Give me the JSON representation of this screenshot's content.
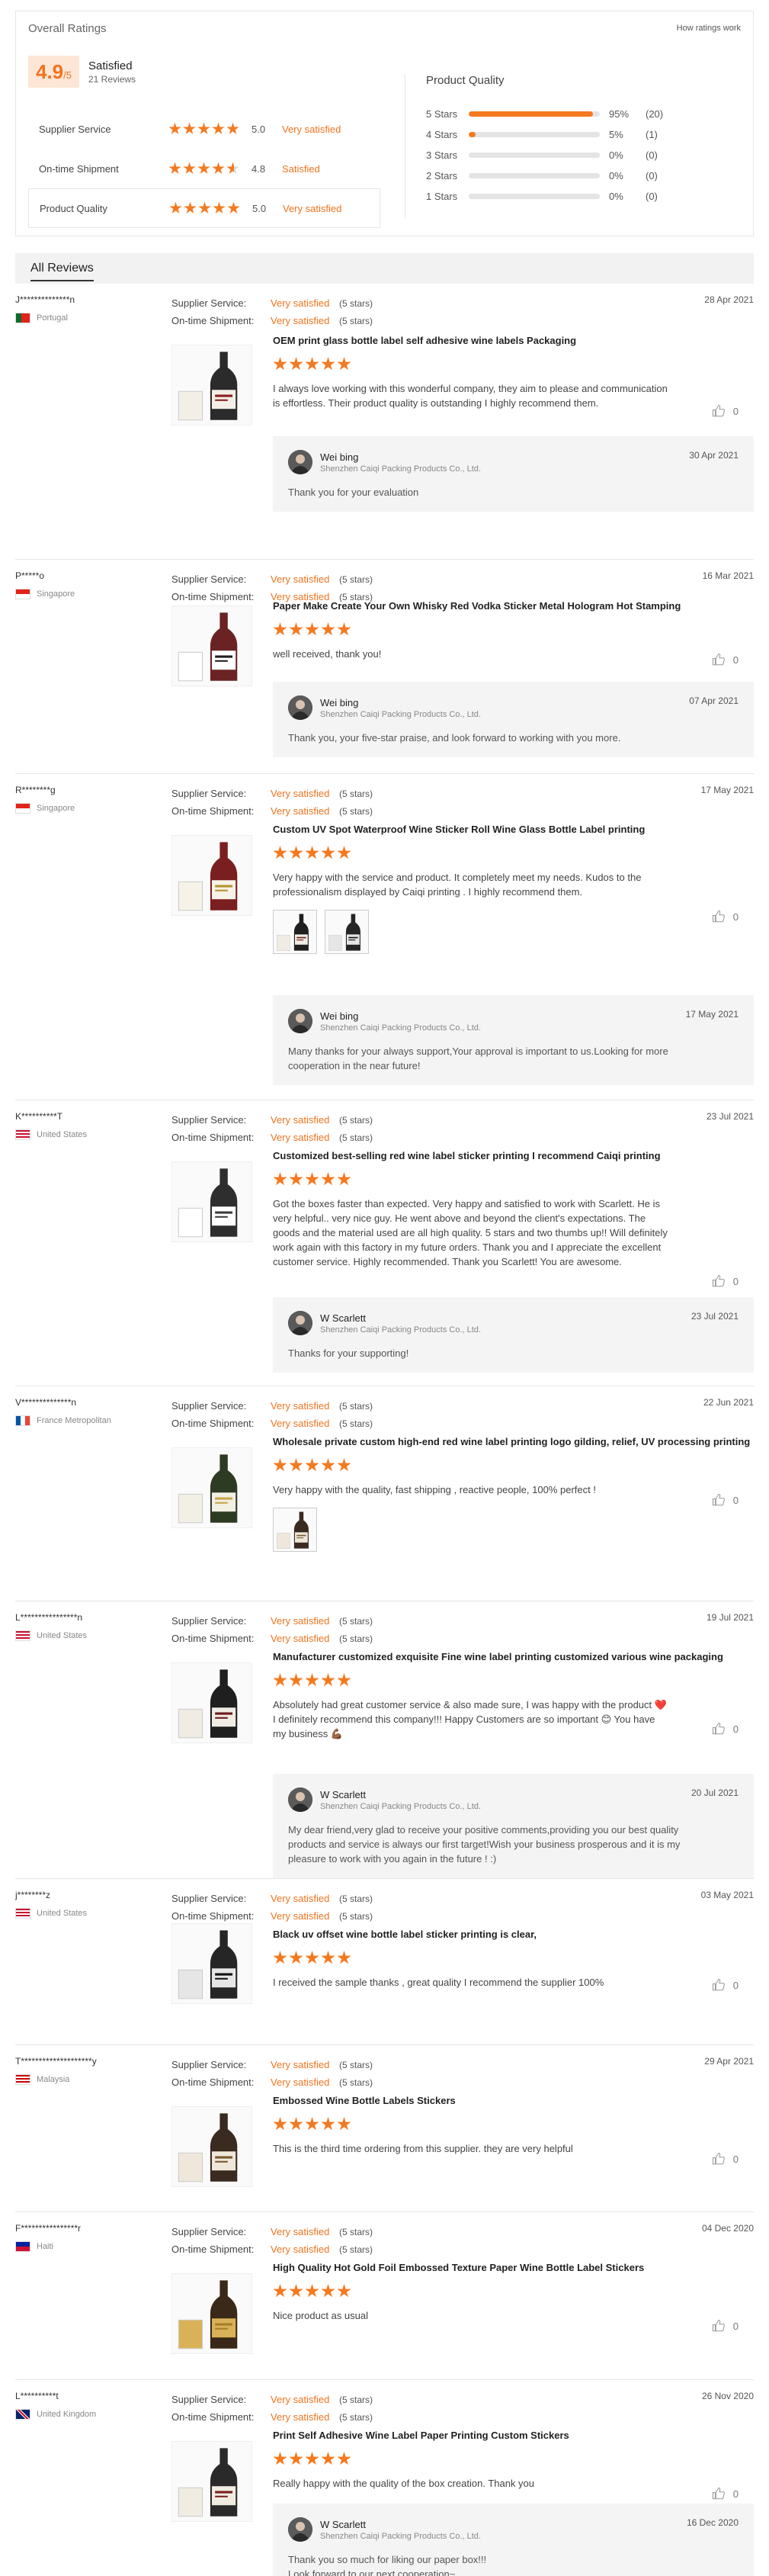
{
  "overall": {
    "title": "Overall Ratings",
    "how_link": "How ratings work",
    "score_main": "4.9",
    "score_sub": "/5",
    "status": "Satisfied",
    "reviews_count": "21 Reviews",
    "sub_ratings": [
      {
        "label": "Supplier Service",
        "value": "5.0",
        "stars": 5,
        "word": "Very satisfied"
      },
      {
        "label": "On-time Shipment",
        "value": "4.8",
        "stars": 4.8,
        "word": "Satisfied"
      },
      {
        "label": "Product Quality",
        "value": "5.0",
        "stars": 5,
        "word": "Very satisfied"
      }
    ],
    "product_quality": {
      "title": "Product Quality",
      "rows": [
        {
          "label": "5 Stars",
          "fraction": 0.95,
          "pct": "95%",
          "count": "(20)"
        },
        {
          "label": "4 Stars",
          "fraction": 0.05,
          "pct": "5%",
          "count": "(1)"
        },
        {
          "label": "3 Stars",
          "fraction": 0,
          "pct": "0%",
          "count": "(0)"
        },
        {
          "label": "2 Stars",
          "fraction": 0,
          "pct": "0%",
          "count": "(0)"
        },
        {
          "label": "1 Stars",
          "fraction": 0,
          "pct": "0%",
          "count": "(0)"
        }
      ]
    }
  },
  "all_reviews_title": "All Reviews",
  "labels": {
    "supplier_service": "Supplier Service:",
    "on_time_shipment": "On-time Shipment:",
    "very_satisfied": "Very satisfied",
    "five_stars": "(5 stars)"
  },
  "reviews": [
    {
      "name": "J**************n",
      "country": "Portugal",
      "date": "28 Apr 2021",
      "title": "OEM print glass bottle label self adhesive wine labels Packaging",
      "text": "I always love working with this wonderful company, they aim to please and communication is effortless.  Their product quality is outstanding I highly recommend them.",
      "likes": "0",
      "reply": {
        "name": "Wei bing",
        "company": "Shenzhen Caiqi Packing Products Co., Ltd.",
        "date": "30 Apr 2021",
        "text": "Thank you for your evaluation"
      }
    },
    {
      "name": "P*****o",
      "country": "Singapore",
      "date": "16 Mar 2021",
      "title": "Paper Make Create Your Own Whisky Red Vodka Sticker Metal Hologram Hot Stamping",
      "text": "well received, thank you!",
      "likes": "0",
      "reply": {
        "name": "Wei bing",
        "company": "Shenzhen Caiqi Packing Products Co., Ltd.",
        "date": "07 Apr 2021",
        "text": "Thank you, your five-star praise, and look forward to working with you more."
      }
    },
    {
      "name": "R********g",
      "country": "Singapore",
      "date": "17 May 2021",
      "title": "Custom UV Spot Waterproof Wine Sticker Roll Wine Glass Bottle Label printing",
      "text": "Very happy with the service and product. It completely meet my needs. Kudos to the professionalism displayed by Caiqi printing . I highly recommend them.",
      "likes": "0",
      "reply": {
        "name": "Wei bing",
        "company": "Shenzhen Caiqi Packing Products Co., Ltd.",
        "date": "17 May 2021",
        "text": "Many thanks for your always support,Your approval is important to us.Looking for more cooperation in the near future!"
      }
    },
    {
      "name": "K**********T",
      "country": "United States",
      "date": "23 Jul 2021",
      "title": "Customized best-selling red wine label sticker printing I recommend Caiqi printing",
      "text": "Got the boxes faster than expected. Very happy and satisfied to work with Scarlett. He is very helpful.. very nice guy. He went above and beyond the client's expectations. The goods and the material used are all high quality. 5 stars and two thumbs up!! Will definitely work again with this factory in my future orders. Thank you and I appreciate the excellent customer service. Highly recommended. Thank you Scarlett! You are awesome.",
      "likes": "0",
      "reply": {
        "name": "W Scarlett",
        "company": "Shenzhen Caiqi Packing Products Co., Ltd.",
        "date": "23 Jul 2021",
        "text": "Thanks for your supporting!"
      }
    },
    {
      "name": "V**************n",
      "country": "France Metropolitan",
      "date": "22 Jun 2021",
      "title": "Wholesale private custom high-end red wine label printing logo gilding, relief, UV processing printing",
      "text": "Very happy with the quality, fast shipping , reactive people, 100% perfect !",
      "likes": "0"
    },
    {
      "name": "L****************n",
      "country": "United States",
      "date": "19 Jul 2021",
      "title": "Manufacturer customized exquisite Fine wine label printing customized various wine packaging",
      "text": "Absolutely had great customer service & also made sure, I was happy with the product ❤️ I definitely recommend this company!!! Happy Customers are so important 😊 You have my business 💪🏾",
      "likes": "0",
      "reply": {
        "name": "W Scarlett",
        "company": "Shenzhen Caiqi Packing Products Co., Ltd.",
        "date": "20 Jul 2021",
        "text": "My dear friend,very glad to receive your positive comments,providing you our best quality products and service is always our first target!Wish your business prosperous and it is my pleasure to work with you again in the future ! :)"
      }
    },
    {
      "name": "j********z",
      "country": "United States",
      "date": "03 May 2021",
      "title": "Black uv offset wine bottle label sticker printing is clear,",
      "text": "I received the sample thanks , great quality I recommend the supplier 100%",
      "likes": "0"
    },
    {
      "name": "T********************y",
      "country": "Malaysia",
      "date": "29 Apr 2021",
      "title": "Embossed Wine Bottle Labels Stickers",
      "text": "This is the third time ordering from this supplier. they are very helpful",
      "likes": "0"
    },
    {
      "name": "F****************r",
      "country": "Haiti",
      "date": "04 Dec 2020",
      "title": "High Quality Hot Gold Foil Embossed Texture Paper Wine Bottle Label Stickers",
      "text": "Nice product as usual",
      "likes": "0"
    },
    {
      "name": "L**********t",
      "country": "United Kingdom",
      "date": "26 Nov 2020",
      "title": "Print Self Adhesive Wine Label Paper Printing Custom Stickers",
      "text": "Really happy with the quality of the box creation.  Thank you",
      "likes": "0",
      "reply": {
        "name": "W Scarlett",
        "company": "Shenzhen Caiqi Packing Products Co., Ltd.",
        "date": "16 Dec 2020",
        "text": "Thank you so much for liking our paper box!!!\nLook forward to our next cooperation~"
      }
    }
  ],
  "colors": {
    "accent": "#f0741e",
    "star": "#f5791f",
    "bar_bg": "#e4e4e4",
    "reply_bg": "#f4f4f5"
  }
}
